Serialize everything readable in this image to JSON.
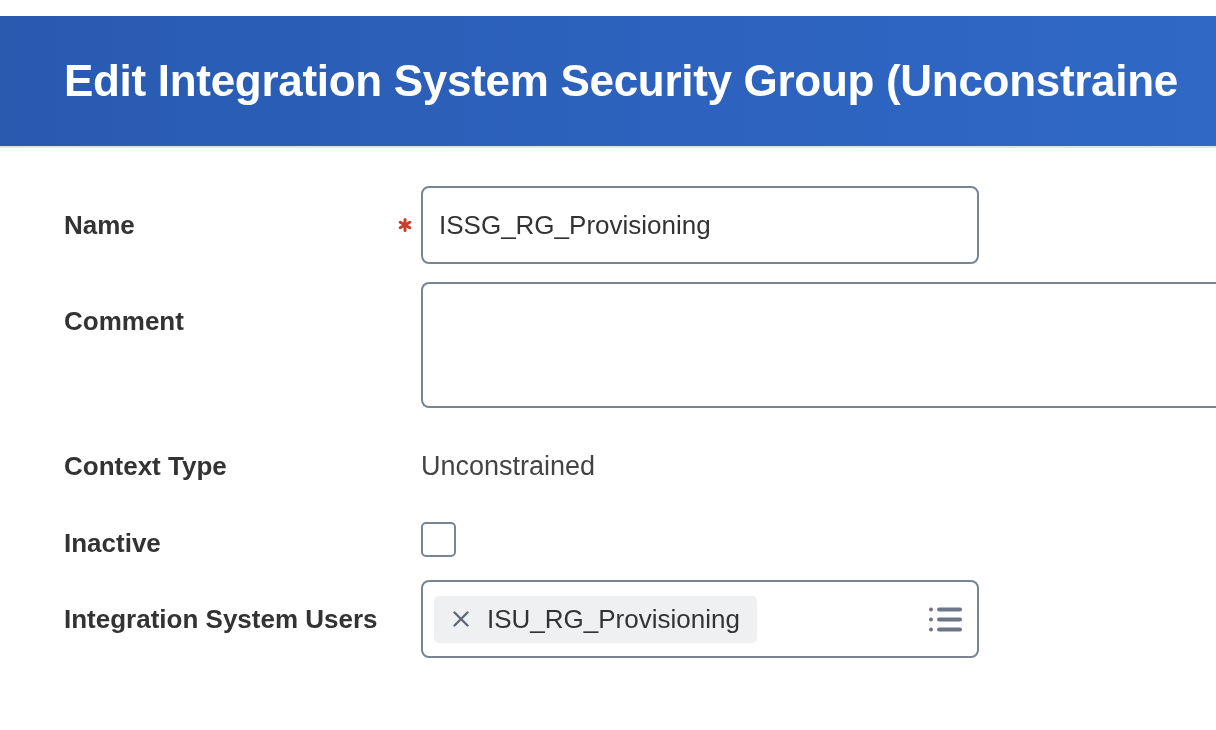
{
  "header": {
    "title": "Edit Integration System Security Group (Unconstraine"
  },
  "form": {
    "fields": [
      {
        "kind": "text",
        "label": "Name",
        "required": true,
        "value": "ISSG_RG_Provisioning"
      },
      {
        "kind": "textarea",
        "label": "Comment",
        "required": false
      },
      {
        "kind": "readonly",
        "label": "Context Type",
        "required": false,
        "value": "Unconstrained"
      },
      {
        "kind": "checkbox",
        "label": "Inactive",
        "required": false,
        "checked": false
      },
      {
        "kind": "multiselect",
        "label": "Integration System Users",
        "required": false,
        "selections": [
          {
            "label": "ISU_RG_Provisioning"
          }
        ]
      }
    ]
  }
}
